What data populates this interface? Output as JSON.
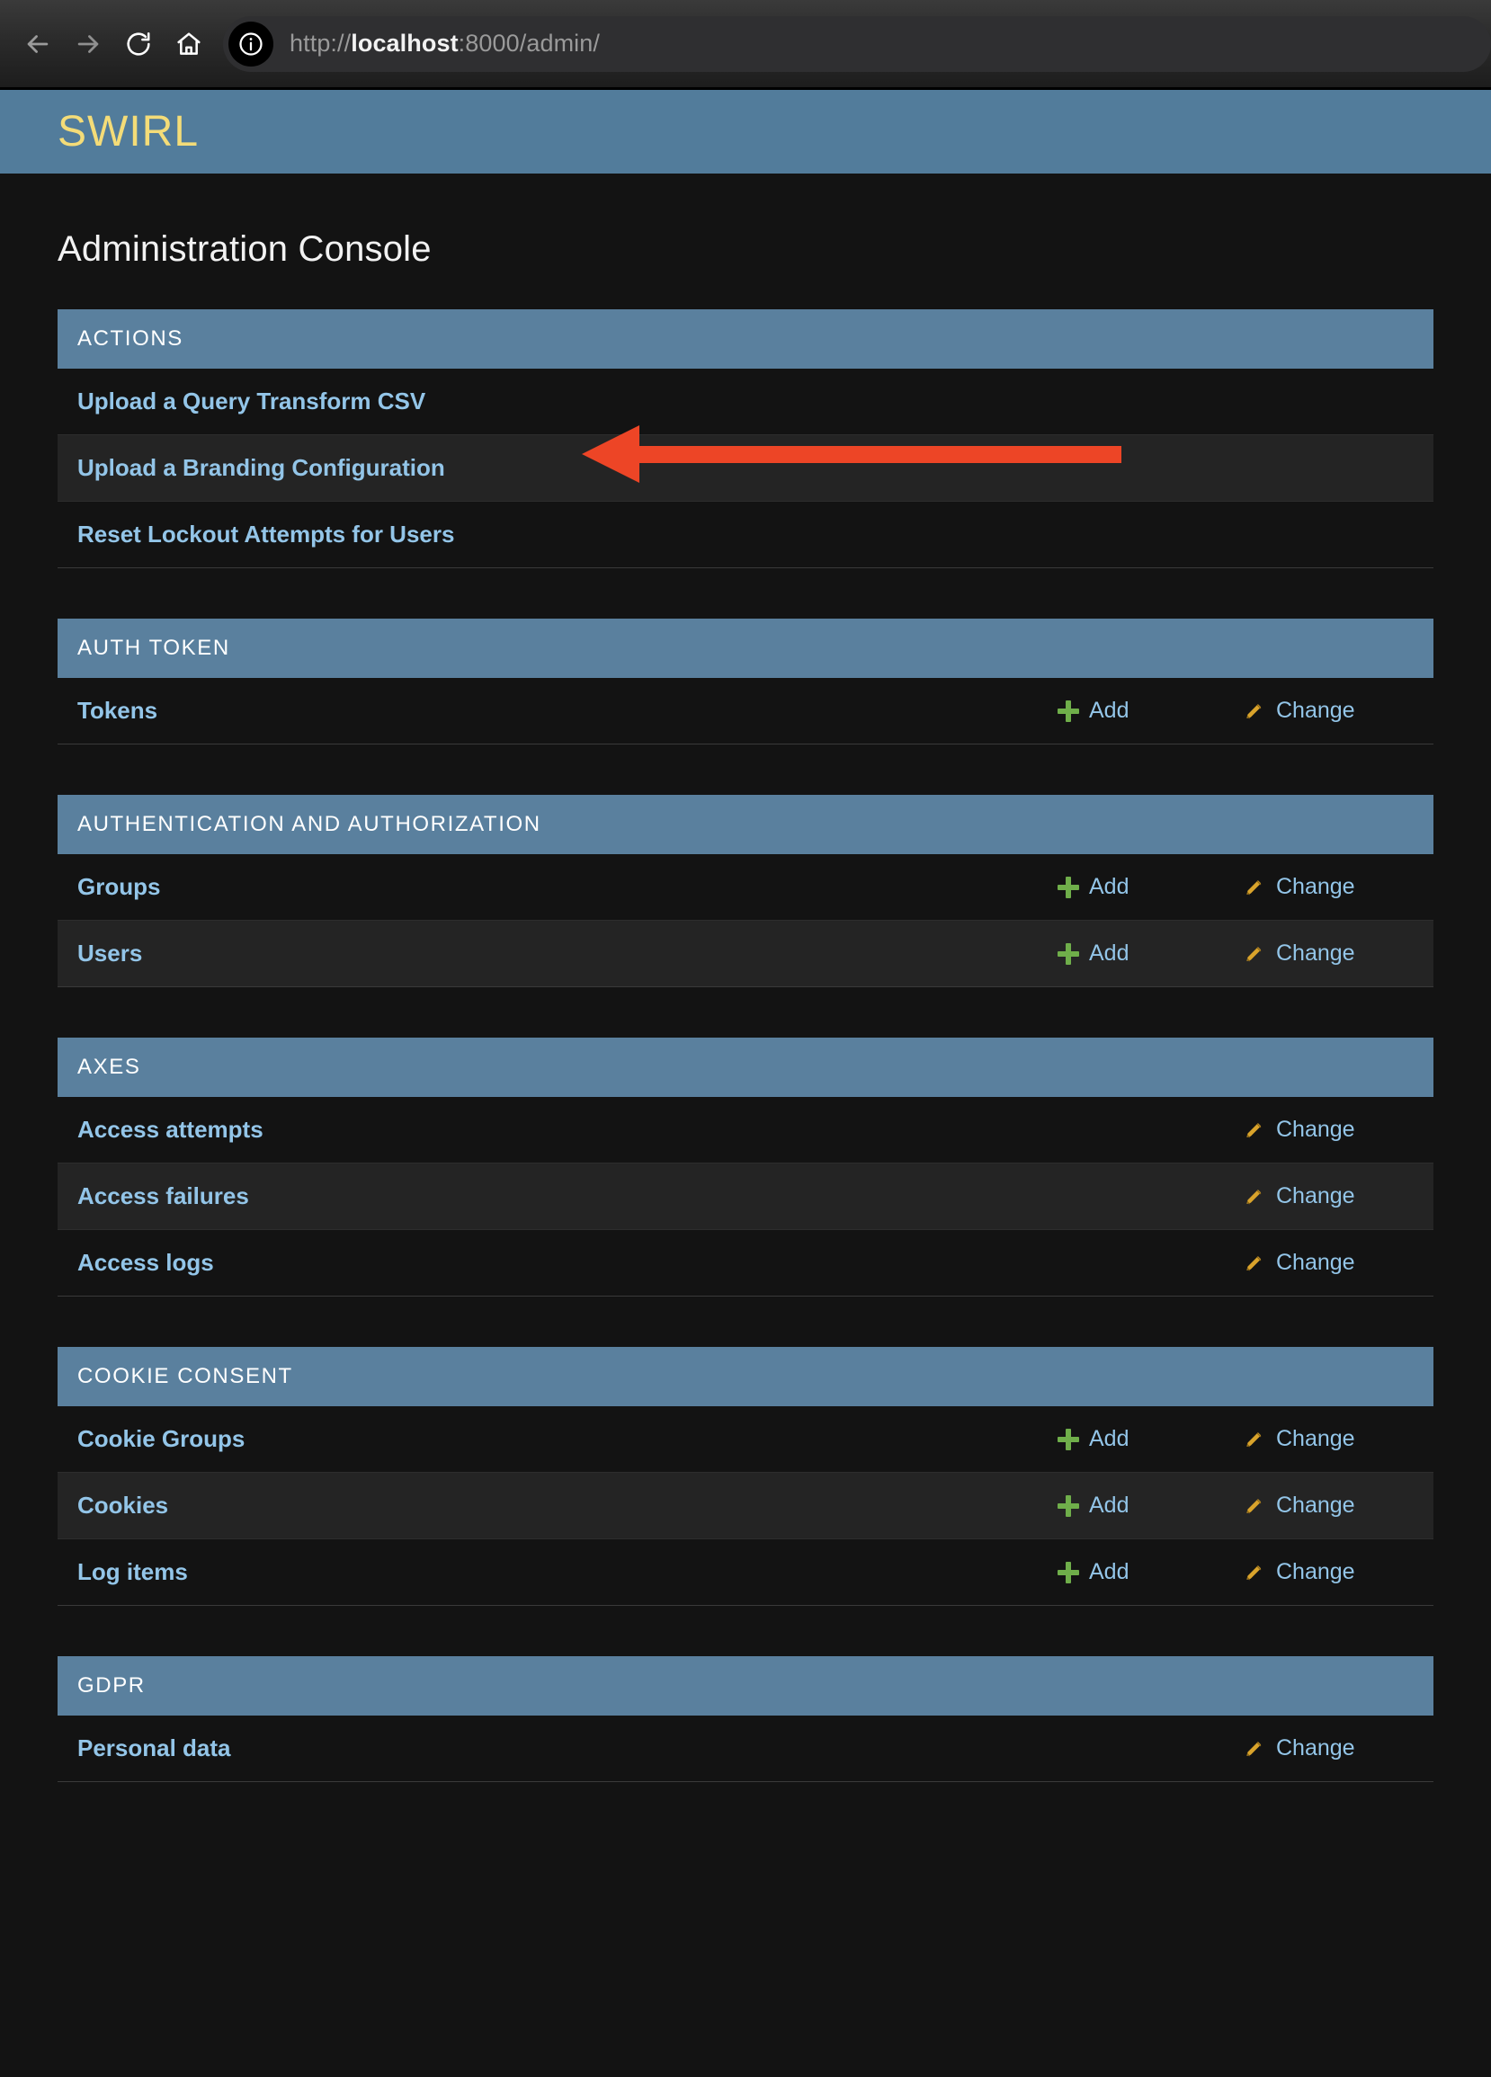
{
  "browser": {
    "back_icon": "arrow-left-icon",
    "forward_icon": "arrow-right-icon",
    "reload_icon": "reload-icon",
    "home_icon": "home-icon",
    "info_icon": "info-icon",
    "url_scheme": "http://",
    "url_host": "localhost",
    "url_rest": ":8000/admin/",
    "url_full": "http://localhost:8000/admin/"
  },
  "header": {
    "brand": "SWIRL",
    "brand_color": "#f4dc78",
    "banner_color": "#527c9b"
  },
  "page": {
    "title": "Administration Console"
  },
  "colors": {
    "module_header_bg": "#5a809e",
    "link": "#93c5e8",
    "add_icon": "#6fae4a",
    "change_icon": "#d9a32b",
    "annotation": "#ed4526"
  },
  "annotation": {
    "type": "arrow-left",
    "target_row": "Upload a Branding Configuration",
    "color": "#ed4526"
  },
  "labels": {
    "add": "Add",
    "change": "Change"
  },
  "modules": [
    {
      "title": "ACTIONS",
      "rows": [
        {
          "label": "Upload a Query Transform CSV",
          "add": false,
          "change": false,
          "highlighted": false
        },
        {
          "label": "Upload a Branding Configuration",
          "add": false,
          "change": false,
          "highlighted": true
        },
        {
          "label": "Reset Lockout Attempts for Users",
          "add": false,
          "change": false,
          "highlighted": false
        }
      ]
    },
    {
      "title": "AUTH TOKEN",
      "rows": [
        {
          "label": "Tokens",
          "add": true,
          "change": true,
          "highlighted": false
        }
      ]
    },
    {
      "title": "AUTHENTICATION AND AUTHORIZATION",
      "rows": [
        {
          "label": "Groups",
          "add": true,
          "change": true,
          "highlighted": false
        },
        {
          "label": "Users",
          "add": true,
          "change": true,
          "highlighted": true
        }
      ]
    },
    {
      "title": "AXES",
      "rows": [
        {
          "label": "Access attempts",
          "add": false,
          "change": true,
          "highlighted": false
        },
        {
          "label": "Access failures",
          "add": false,
          "change": true,
          "highlighted": true
        },
        {
          "label": "Access logs",
          "add": false,
          "change": true,
          "highlighted": false
        }
      ]
    },
    {
      "title": "COOKIE CONSENT",
      "rows": [
        {
          "label": "Cookie Groups",
          "add": true,
          "change": true,
          "highlighted": false
        },
        {
          "label": "Cookies",
          "add": true,
          "change": true,
          "highlighted": true
        },
        {
          "label": "Log items",
          "add": true,
          "change": true,
          "highlighted": false
        }
      ]
    },
    {
      "title": "GDPR",
      "rows": [
        {
          "label": "Personal data",
          "add": false,
          "change": true,
          "highlighted": false
        }
      ]
    }
  ]
}
